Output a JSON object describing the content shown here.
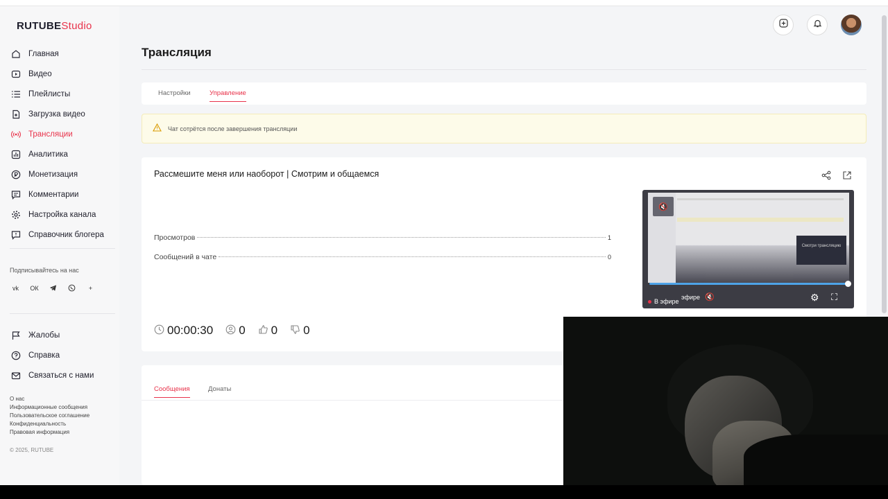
{
  "app": {
    "logo_main": "RUTUBE",
    "logo_studio": "Studio"
  },
  "sidebar": {
    "items": [
      {
        "label": "Главная",
        "icon": "home-icon"
      },
      {
        "label": "Видео",
        "icon": "video-icon"
      },
      {
        "label": "Плейлисты",
        "icon": "playlist-icon"
      },
      {
        "label": "Загрузка видео",
        "icon": "upload-icon"
      },
      {
        "label": "Трансляции",
        "icon": "broadcast-icon",
        "active": true
      },
      {
        "label": "Аналитика",
        "icon": "analytics-icon"
      },
      {
        "label": "Монетизация",
        "icon": "monetization-icon"
      },
      {
        "label": "Комментарии",
        "icon": "comments-icon"
      },
      {
        "label": "Настройка канала",
        "icon": "gear-icon"
      },
      {
        "label": "Справочник блогера",
        "icon": "info-icon"
      }
    ],
    "subscribe_title": "Подписывайтесь на нас",
    "socials": [
      "vk-icon",
      "ok-icon",
      "telegram-icon",
      "viber-icon",
      "plus-icon"
    ],
    "secondary": [
      {
        "label": "Жалобы",
        "icon": "flag-icon"
      },
      {
        "label": "Справка",
        "icon": "help-icon"
      },
      {
        "label": "Связаться с нами",
        "icon": "mail-icon"
      }
    ],
    "footer_links": [
      "О нас",
      "Информационные сообщения",
      "Пользовательское соглашение",
      "Конфиденциальность",
      "Правовая информация"
    ],
    "copyright": "© 2025, RUTUBE"
  },
  "header": {
    "icons": [
      "add-icon",
      "bell-icon",
      "avatar"
    ]
  },
  "page": {
    "title": "Трансляция",
    "tabs": [
      {
        "label": "Настройки",
        "active": false
      },
      {
        "label": "Управление",
        "active": true
      }
    ],
    "alert": "Чат сотрётся после завершения трансляции"
  },
  "stream": {
    "title": "Рассмешите меня или наоборот | Смотрим и общаемся",
    "stats": [
      {
        "label": "Просмотров",
        "value": "1"
      },
      {
        "label": "Сообщений в чате",
        "value": "0"
      }
    ],
    "metrics": {
      "duration": "00:00:30",
      "viewers": "0",
      "likes": "0",
      "dislikes": "0"
    },
    "player": {
      "live_label": "В эфире",
      "live_label_ghost": "эфире",
      "preview_text": "Смотри трансляцию",
      "progress": 1.0
    }
  },
  "chat": {
    "tabs": [
      {
        "label": "Сообщения",
        "active": true
      },
      {
        "label": "Донаты",
        "active": false
      }
    ]
  },
  "colors": {
    "accent": "#e8324a",
    "alert_bg": "#fdfbe9",
    "progress": "#4ea3e8"
  }
}
